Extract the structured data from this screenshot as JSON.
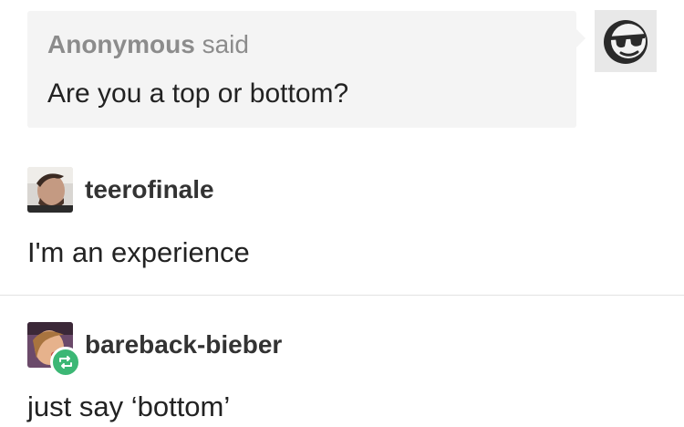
{
  "ask": {
    "asker": "Anonymous",
    "said": "said",
    "question": "Are you a top or bottom?",
    "asker_avatar_icon": "sunglasses-face-icon"
  },
  "posts": [
    {
      "username": "teerofinale",
      "text": "I'm an experience",
      "avatar_icon": "user-photo-avatar"
    },
    {
      "username": "bareback-bieber",
      "text": "just say ‘bottom’",
      "avatar_icon": "user-photo-avatar",
      "badge_icon": "reblog-icon"
    }
  ],
  "colors": {
    "ask_background": "#f4f4f4",
    "reblog_badge": "#3cb775",
    "divider": "#e2e2e2"
  }
}
